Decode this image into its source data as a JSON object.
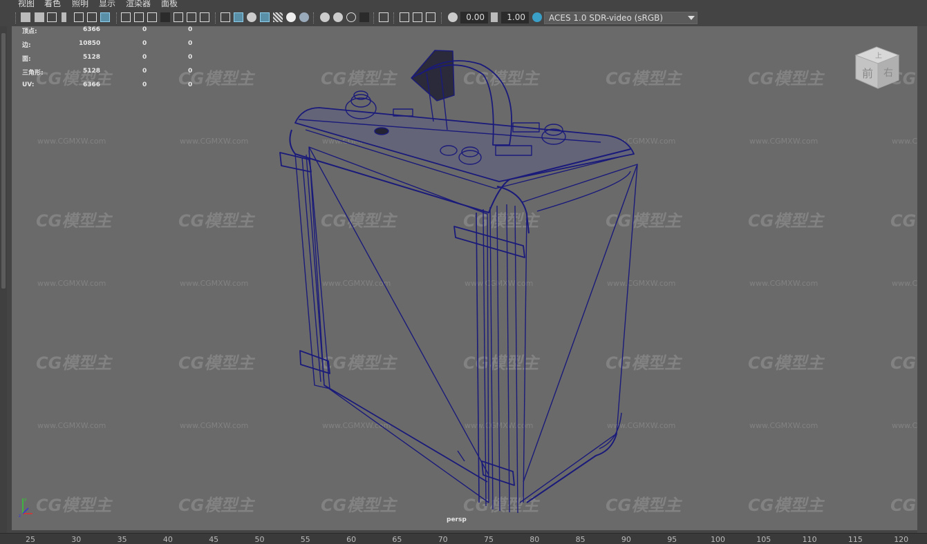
{
  "menu": [
    "视图",
    "着色",
    "照明",
    "显示",
    "渲染器",
    "面板"
  ],
  "toolbar": {
    "exposure": "0.00",
    "gamma": "1.00",
    "color_space": "ACES 1.0 SDR-video (sRGB)"
  },
  "hud": [
    {
      "label": "顶点:",
      "v1": "6366",
      "v2": "0",
      "v3": "0"
    },
    {
      "label": "边:",
      "v1": "10850",
      "v2": "0",
      "v3": "0"
    },
    {
      "label": "面:",
      "v1": "5128",
      "v2": "0",
      "v3": "0"
    },
    {
      "label": "三角形:",
      "v1": "5128",
      "v2": "0",
      "v3": "0"
    },
    {
      "label": "UV:",
      "v1": "6366",
      "v2": "0",
      "v3": "0"
    }
  ],
  "viewcube": {
    "top": "上",
    "front": "前",
    "right": "右"
  },
  "watermark": {
    "logo": "CG模型主",
    "url": "www.CGMXW.com"
  },
  "camera": "persp",
  "timeline_ticks": [
    "25",
    "30",
    "35",
    "40",
    "45",
    "50",
    "55",
    "60",
    "65",
    "70",
    "75",
    "80",
    "85",
    "90",
    "95",
    "100",
    "105",
    "110",
    "115",
    "120"
  ],
  "colors": {
    "wire": "#1a1a7a",
    "viewport_bg": "#6a6a6a",
    "highlight": "#5a8fa8"
  }
}
